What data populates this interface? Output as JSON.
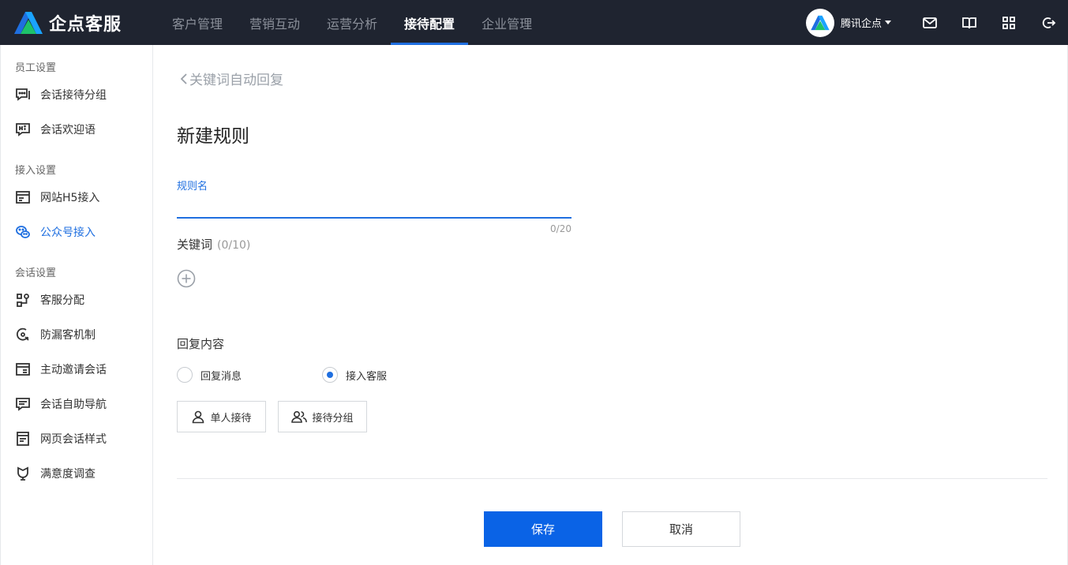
{
  "app": {
    "name": "企点客服"
  },
  "nav": {
    "items": [
      {
        "label": "客户管理"
      },
      {
        "label": "营销互动"
      },
      {
        "label": "运营分析"
      },
      {
        "label": "接待配置"
      },
      {
        "label": "企业管理"
      }
    ],
    "active": "接待配置"
  },
  "account": {
    "name": "腾讯企点"
  },
  "top_icons": [
    "mail-icon",
    "book-icon",
    "apps-grid-icon",
    "logout-icon"
  ],
  "sidebar": {
    "sections": [
      {
        "title": "员工设置",
        "items": [
          {
            "label": "会话接待分组",
            "icon": "chat-group-icon"
          },
          {
            "label": "会话欢迎语",
            "icon": "hi-message-icon"
          }
        ]
      },
      {
        "title": "接入设置",
        "items": [
          {
            "label": "网站H5接入",
            "icon": "web-window-icon"
          },
          {
            "label": "公众号接入",
            "icon": "wechat-icon",
            "active": true
          }
        ]
      },
      {
        "title": "会话设置",
        "items": [
          {
            "label": "客服分配",
            "icon": "distribute-icon"
          },
          {
            "label": "防漏客机制",
            "icon": "guard-icon"
          },
          {
            "label": "主动邀请会话",
            "icon": "invite-icon"
          },
          {
            "label": "会话自助导航",
            "icon": "navigation-icon"
          },
          {
            "label": "网页会话样式",
            "icon": "page-style-icon"
          },
          {
            "label": "满意度调查",
            "icon": "survey-icon"
          }
        ]
      }
    ]
  },
  "main": {
    "back_label": "关键词自动回复",
    "title": "新建规则",
    "rule_name": {
      "label": "规则名",
      "value": "",
      "counter": "0/20"
    },
    "keywords": {
      "label": "关键词",
      "count": "(0/10)"
    },
    "reply": {
      "label": "回复内容",
      "options": [
        {
          "label": "回复消息",
          "checked": false
        },
        {
          "label": "接入客服",
          "checked": true
        }
      ],
      "buttons": [
        {
          "label": "单人接待"
        },
        {
          "label": "接待分组"
        }
      ]
    },
    "save_label": "保存",
    "cancel_label": "取消"
  },
  "colors": {
    "accent": "#1f6fe0",
    "topbar": "#1f2430",
    "save": "#0a63e6"
  }
}
